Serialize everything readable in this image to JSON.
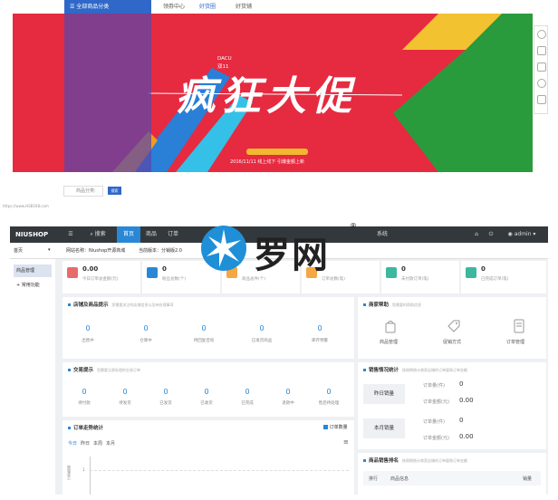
{
  "storefront": {
    "category_button": "全部商品分类",
    "nav_links": [
      "领券中心",
      "好货圈",
      "好货铺"
    ],
    "banner": {
      "brand_line1": "DACU",
      "brand_line2": "双11",
      "slogan": "疯狂大促",
      "tagline": "2016/11/11 线上线下 引爆金额上新"
    },
    "search_label": "商品分类:",
    "search_button": "搜索",
    "url_text": "https://www.HSB168.com"
  },
  "admin": {
    "logo": "NIUSHOP",
    "nav": {
      "search": "搜索",
      "home": "首页",
      "goods": "商品",
      "orders": "订单",
      "system": "系统",
      "user": "admin"
    },
    "subbar": {
      "site_name": "网站名称：Niushop开源商城",
      "version": "当前版本：分销版2.0"
    },
    "sidebar": {
      "dropdown": "首页",
      "items": [
        "商品管理",
        "常用功能"
      ]
    },
    "stats": [
      {
        "value": "0.00",
        "label": "今日订单总金额(元)",
        "color": "#e86a6a"
      },
      {
        "value": "0",
        "label": "粉丝总数(个)",
        "color": "#2a87d6"
      },
      {
        "value": "",
        "label": "商品总件(个)",
        "color": "#f4a742"
      },
      {
        "value": "",
        "label": "订单总数(笔)",
        "color": "#f4a742"
      },
      {
        "value": "0",
        "label": "未付款订单(笔)",
        "color": "#3cb89c"
      },
      {
        "value": "0",
        "label": "已完成订单(笔)",
        "color": "#3cb89c"
      }
    ],
    "shop_panel": {
      "title": "店铺及商品提示",
      "subtitle": "您需要关注的店铺信息以及待处理事项",
      "items": [
        {
          "value": "0",
          "label": "出售中"
        },
        {
          "value": "0",
          "label": "仓库中"
        },
        {
          "value": "0",
          "label": "待回复咨询"
        },
        {
          "value": "0",
          "label": "已发货商品"
        },
        {
          "value": "0",
          "label": "库存预警"
        }
      ]
    },
    "trade_panel": {
      "title": "交易提示",
      "subtitle": "您需要立即处理的交易订单",
      "items": [
        {
          "value": "0",
          "label": "待付款"
        },
        {
          "value": "0",
          "label": "待发货"
        },
        {
          "value": "0",
          "label": "已发货"
        },
        {
          "value": "0",
          "label": "已收货"
        },
        {
          "value": "0",
          "label": "已完成"
        },
        {
          "value": "0",
          "label": "退款中"
        },
        {
          "value": "0",
          "label": "售后待处理"
        }
      ]
    },
    "help_panel": {
      "title": "商家帮助",
      "subtitle": "您需要的帮助信息",
      "items": [
        "商品管理",
        "促销方式",
        "订单管理"
      ]
    },
    "sales_panel": {
      "title": "销售情况统计",
      "subtitle": "按周期统计商家店铺的订单量和订单金额",
      "rows": [
        {
          "label": "昨日销量",
          "count_label": "订单量(件)",
          "count": "0",
          "amount_label": "订单金额(元)",
          "amount": "0.00"
        },
        {
          "label": "本月销量",
          "count_label": "订单量(件)",
          "count": "0",
          "amount_label": "订单金额(元)",
          "amount": "0.00"
        }
      ]
    },
    "order_chart": {
      "title": "订单走势统计",
      "legend": "订单数量",
      "tabs": [
        "今日",
        "昨日",
        "本周",
        "本月"
      ],
      "y_axis_label": "订单数量",
      "y_tick": "1"
    },
    "ranking_panel": {
      "title": "商品销售排名",
      "subtitle": "按周期统计商家店铺的订单量和订单金额",
      "headers": [
        "排行",
        "商品信息",
        "销量"
      ]
    }
  },
  "watermark": {
    "text": "罗网",
    "reg": "®"
  },
  "colors": {
    "primary": "#2a87d6",
    "topbar": "#33383d",
    "banner_red": "#e62a40",
    "store_blue": "#2f68c8"
  }
}
